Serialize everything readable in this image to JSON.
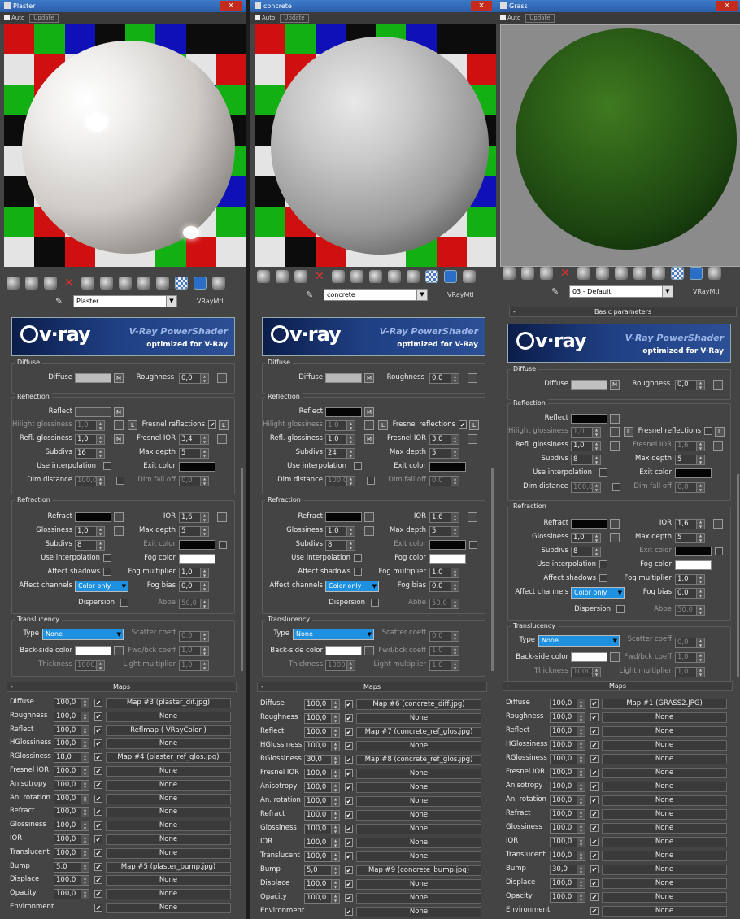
{
  "colors": {
    "checker_red": "#d01010",
    "checker_green": "#12b012",
    "checker_blue": "#1010b8",
    "checker_white": "#e4e4e4",
    "checker_black": "#0c0c0c",
    "accent": "#1e90e0",
    "titlebar": "#2f69b4"
  },
  "icons": {
    "toolbar": [
      "sample-sphere-icon",
      "put-to-scene-icon",
      "assign-material-icon",
      "delete-icon",
      "copy-material-icon",
      "unique-icon",
      "put-library-icon",
      "material-id-icon",
      "show-map-icon",
      "show-end-result-icon",
      "go-parent-icon",
      "go-sibling-icon"
    ]
  },
  "common": {
    "auto": "Auto",
    "update": "Update",
    "material_type": "VRayMtl",
    "basic_parameters": "Basic parameters",
    "banner_logo": "v·ray",
    "banner_title": "V-Ray PowerShader",
    "banner_subtitle": "optimized for V-Ray",
    "diffuse_group": "Diffuse",
    "diffuse": "Diffuse",
    "roughness": "Roughness",
    "m": "M",
    "l": "L",
    "reflection_group": "Reflection",
    "reflect": "Reflect",
    "hilight_glossiness": "Hilight glossiness",
    "fresnel_reflections": "Fresnel reflections",
    "refl_glossiness": "Refl. glossiness",
    "fresnel_ior": "Fresnel IOR",
    "subdivs": "Subdivs",
    "max_depth": "Max depth",
    "use_interpolation": "Use interpolation",
    "exit_color": "Exit color",
    "dim_distance": "Dim distance",
    "dim_fall_off": "Dim fall off",
    "refraction_group": "Refraction",
    "refract": "Refract",
    "ior": "IOR",
    "glossiness": "Glossiness",
    "fog_color": "Fog color",
    "affect_shadows": "Affect shadows",
    "fog_multiplier": "Fog multiplier",
    "affect_channels": "Affect channels",
    "fog_bias": "Fog bias",
    "dispersion": "Dispersion",
    "abbe": "Abbe",
    "translucency_group": "Translucency",
    "type": "Type",
    "scatter_coeff": "Scatter coeff",
    "back_side_color": "Back-side color",
    "fwd_bck_coeff": "Fwd/bck coeff",
    "thickness": "Thickness",
    "light_multiplier": "Light multiplier",
    "minus": "-",
    "maps": "Maps",
    "map_names": [
      "Diffuse",
      "Roughness",
      "Reflect",
      "HGlossiness",
      "RGlossiness",
      "Fresnel IOR",
      "Anisotropy",
      "An. rotation",
      "Refract",
      "Glossiness",
      "IOR",
      "Translucent",
      "Bump",
      "Displace",
      "Opacity",
      "Environment"
    ]
  },
  "panels": [
    {
      "window_title": "Plaster",
      "close": "×",
      "material_name": "Plaster",
      "diffuse_color": "#bdbdbd",
      "reflect_color": "#4a4a4a",
      "roughness": "0,0",
      "hilight_glossiness": "1,0",
      "refl_glossiness": "1,0",
      "fresnel_ior": "3,4",
      "fresnel_checked": "✔",
      "subdivs": "16",
      "max_depth": "5",
      "dim_distance": "100,0m",
      "dim_fall_off": "0,0",
      "ior": "1,6",
      "glossiness": "1,0",
      "refr_subdivs": "8",
      "refr_max_depth": "5",
      "fog_multiplier": "1,0",
      "affect_channels": "Color only",
      "fog_bias": "0,0",
      "abbe": "50,0",
      "trans_type": "None",
      "scatter_coeff": "0,0",
      "fwd_bck_coeff": "1,0",
      "thickness": "1000,0",
      "light_multiplier": "1,0",
      "maps": [
        {
          "amount": "100,0",
          "on": "✔",
          "map": "Map #3 (plaster_dif.jpg)"
        },
        {
          "amount": "100,0",
          "on": "✔",
          "map": "None"
        },
        {
          "amount": "100,0",
          "on": "✔",
          "map": "Reflmap  ( VRayColor )"
        },
        {
          "amount": "100,0",
          "on": "✔",
          "map": "None"
        },
        {
          "amount": "18,0",
          "on": "✔",
          "map": "Map #4 (plaster_ref_glos.jpg)"
        },
        {
          "amount": "100,0",
          "on": "✔",
          "map": "None"
        },
        {
          "amount": "100,0",
          "on": "✔",
          "map": "None"
        },
        {
          "amount": "100,0",
          "on": "✔",
          "map": "None"
        },
        {
          "amount": "100,0",
          "on": "✔",
          "map": "None"
        },
        {
          "amount": "100,0",
          "on": "✔",
          "map": "None"
        },
        {
          "amount": "100,0",
          "on": "✔",
          "map": "None"
        },
        {
          "amount": "100,0",
          "on": "✔",
          "map": "None"
        },
        {
          "amount": "5,0",
          "on": "✔",
          "map": "Map #5 (plaster_bump.jpg)"
        },
        {
          "amount": "100,0",
          "on": "✔",
          "map": "None"
        },
        {
          "amount": "100,0",
          "on": "✔",
          "map": "None"
        },
        {
          "amount": "",
          "on": "✔",
          "map": "None"
        }
      ]
    },
    {
      "window_title": "concrete",
      "close": "×",
      "material_name": "concrete",
      "diffuse_color": "#b8b8b8",
      "reflect_color": "#050505",
      "roughness": "0,0",
      "hilight_glossiness": "1,0",
      "refl_glossiness": "1,0",
      "fresnel_ior": "3,0",
      "fresnel_checked": "✔",
      "subdivs": "24",
      "max_depth": "5",
      "dim_distance": "100,0m",
      "dim_fall_off": "0,0",
      "ior": "1,6",
      "glossiness": "1,0",
      "refr_subdivs": "8",
      "refr_max_depth": "5",
      "fog_multiplier": "1,0",
      "affect_channels": "Color only",
      "fog_bias": "0,0",
      "abbe": "50,0",
      "trans_type": "None",
      "scatter_coeff": "0,0",
      "fwd_bck_coeff": "1,0",
      "thickness": "1000,0",
      "light_multiplier": "1,0",
      "maps": [
        {
          "amount": "100,0",
          "on": "✔",
          "map": "Map #6 (concrete_diff.jpg)"
        },
        {
          "amount": "100,0",
          "on": "✔",
          "map": "None"
        },
        {
          "amount": "100,0",
          "on": "✔",
          "map": "Map #7 (concrete_ref_glos.jpg)"
        },
        {
          "amount": "100,0",
          "on": "✔",
          "map": "None"
        },
        {
          "amount": "30,0",
          "on": "✔",
          "map": "Map #8 (concrete_ref_glos.jpg)"
        },
        {
          "amount": "100,0",
          "on": "✔",
          "map": "None"
        },
        {
          "amount": "100,0",
          "on": "✔",
          "map": "None"
        },
        {
          "amount": "100,0",
          "on": "✔",
          "map": "None"
        },
        {
          "amount": "100,0",
          "on": "✔",
          "map": "None"
        },
        {
          "amount": "100,0",
          "on": "✔",
          "map": "None"
        },
        {
          "amount": "100,0",
          "on": "✔",
          "map": "None"
        },
        {
          "amount": "100,0",
          "on": "✔",
          "map": "None"
        },
        {
          "amount": "5,0",
          "on": "✔",
          "map": "Map #9 (concrete_bump.jpg)"
        },
        {
          "amount": "100,0",
          "on": "✔",
          "map": "None"
        },
        {
          "amount": "100,0",
          "on": "✔",
          "map": "None"
        },
        {
          "amount": "",
          "on": "✔",
          "map": "None"
        }
      ]
    },
    {
      "window_title": "Grass",
      "close": "×",
      "material_name": "03 - Default",
      "diffuse_color": "#c0c0c0",
      "reflect_color": "#050505",
      "roughness": "0,0",
      "hilight_glossiness": "1,0",
      "refl_glossiness": "1,0",
      "fresnel_ior": "1,6",
      "fresnel_checked": "",
      "subdivs": "8",
      "max_depth": "5",
      "dim_distance": "100,0m",
      "dim_fall_off": "0,0",
      "ior": "1,6",
      "glossiness": "1,0",
      "refr_subdivs": "8",
      "refr_max_depth": "5",
      "fog_multiplier": "1,0",
      "affect_channels": "Color only",
      "fog_bias": "0,0",
      "abbe": "50,0",
      "trans_type": "None",
      "scatter_coeff": "0,0",
      "fwd_bck_coeff": "1,0",
      "thickness": "1000,0",
      "light_multiplier": "1,0",
      "maps": [
        {
          "amount": "100,0",
          "on": "✔",
          "map": "Map #1 (GRASS2.JPG)"
        },
        {
          "amount": "100,0",
          "on": "✔",
          "map": "None"
        },
        {
          "amount": "100,0",
          "on": "✔",
          "map": "None"
        },
        {
          "amount": "100,0",
          "on": "✔",
          "map": "None"
        },
        {
          "amount": "100,0",
          "on": "✔",
          "map": "None"
        },
        {
          "amount": "100,0",
          "on": "✔",
          "map": "None"
        },
        {
          "amount": "100,0",
          "on": "✔",
          "map": "None"
        },
        {
          "amount": "100,0",
          "on": "✔",
          "map": "None"
        },
        {
          "amount": "100,0",
          "on": "✔",
          "map": "None"
        },
        {
          "amount": "100,0",
          "on": "✔",
          "map": "None"
        },
        {
          "amount": "100,0",
          "on": "✔",
          "map": "None"
        },
        {
          "amount": "100,0",
          "on": "✔",
          "map": "None"
        },
        {
          "amount": "30,0",
          "on": "✔",
          "map": "None"
        },
        {
          "amount": "100,0",
          "on": "✔",
          "map": "None"
        },
        {
          "amount": "100,0",
          "on": "✔",
          "map": "None"
        },
        {
          "amount": "",
          "on": "✔",
          "map": "None"
        }
      ]
    }
  ]
}
